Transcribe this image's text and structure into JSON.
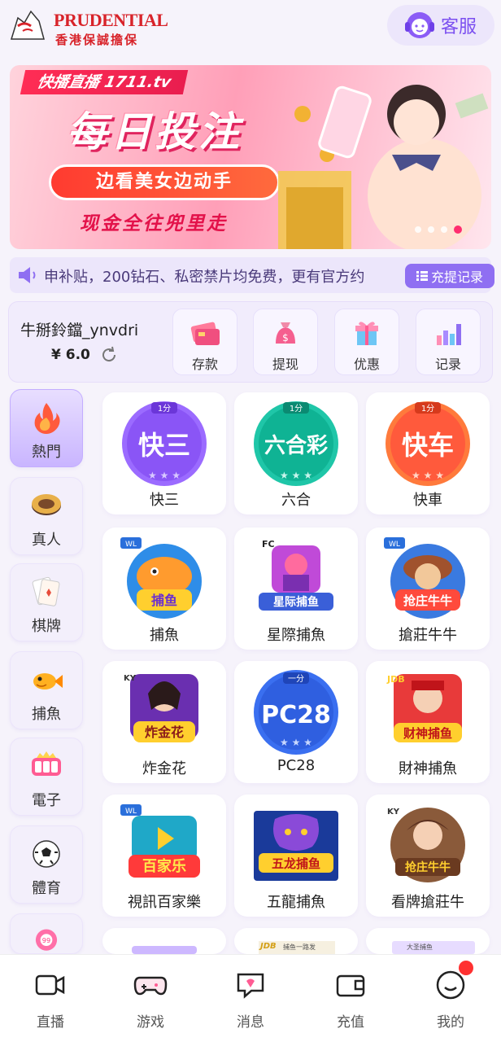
{
  "header": {
    "logo_name": "PRUDENTIAL",
    "logo_sub": "香港保誠擔保",
    "service_label": "客服"
  },
  "banner": {
    "tag": "快播直播 1711.tv",
    "title": "每日投注",
    "subtitle": "边看美女边动手",
    "subtitle2": "现金全往兜里走",
    "slide_count": 4,
    "active_slide": 4
  },
  "notice": {
    "text": "申补贴，200钻石、私密禁片均免费，更有官方约",
    "records_label": "充提记录"
  },
  "wallet": {
    "username": "牛掰鈴鐺_ynvdri",
    "balance": "¥ 6.0",
    "actions": [
      {
        "label": "存款",
        "icon": "card-icon"
      },
      {
        "label": "提现",
        "icon": "money-bag-icon"
      },
      {
        "label": "优惠",
        "icon": "gift-icon"
      },
      {
        "label": "记录",
        "icon": "bar-chart-icon"
      }
    ]
  },
  "categories": [
    {
      "label": "熱門",
      "icon": "fire-icon"
    },
    {
      "label": "真人",
      "icon": "chip-icon"
    },
    {
      "label": "棋牌",
      "icon": "cards-icon"
    },
    {
      "label": "捕魚",
      "icon": "fish-icon"
    },
    {
      "label": "電子",
      "icon": "slot-icon"
    },
    {
      "label": "體育",
      "icon": "football-icon"
    },
    {
      "label": "99",
      "icon": "lottery-ball-icon"
    }
  ],
  "games": [
    {
      "label": "快三",
      "icon_text": "快三",
      "badge": "1分"
    },
    {
      "label": "六合",
      "icon_text": "六合彩",
      "badge": "1分"
    },
    {
      "label": "快車",
      "icon_text": "快车",
      "badge": "1分"
    },
    {
      "label": "捕魚",
      "icon_text": "捕鱼",
      "brand": "WL"
    },
    {
      "label": "星際捕魚",
      "icon_text": "星际捕鱼",
      "brand": "FC"
    },
    {
      "label": "搶莊牛牛",
      "icon_text": "抢庄牛牛",
      "brand": "WL"
    },
    {
      "label": "炸金花",
      "icon_text": "炸金花",
      "brand": "KY"
    },
    {
      "label": "PC28",
      "icon_text": "PC28",
      "badge": "一分"
    },
    {
      "label": "財神捕魚",
      "icon_text": "财神捕鱼",
      "brand": "JDB"
    },
    {
      "label": "視訊百家樂",
      "icon_text": "百家乐",
      "brand": "WL"
    },
    {
      "label": "五龍捕魚",
      "icon_text": "五龙捕鱼"
    },
    {
      "label": "看牌搶莊牛",
      "icon_text": "抢庄牛牛",
      "brand": "KY"
    }
  ],
  "partial_row": {
    "jdb_text": "JDB",
    "jdb_caption": "捕鱼一路发",
    "ky_caption": "大圣捕鱼"
  },
  "bottom_nav": [
    {
      "label": "直播",
      "icon": "camera-icon"
    },
    {
      "label": "游戏",
      "icon": "gamepad-icon"
    },
    {
      "label": "消息",
      "icon": "message-icon"
    },
    {
      "label": "充值",
      "icon": "wallet-icon"
    },
    {
      "label": "我的",
      "icon": "smile-icon"
    }
  ],
  "colors": {
    "accent": "#7b4ff0",
    "brand_red": "#d8232a",
    "badge_red": "#ff3131"
  }
}
